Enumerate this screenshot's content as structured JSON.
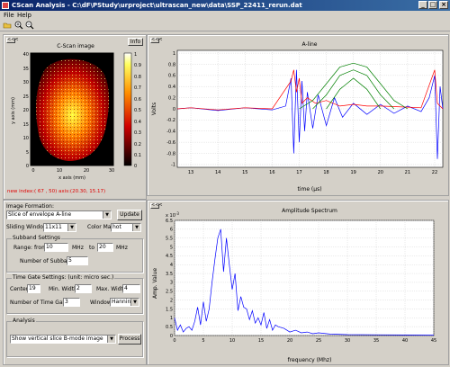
{
  "window": {
    "title": "CScan Analysis - C:\\dF\\PStudy\\urproject\\ultrascan_new\\data\\SSP_22411_rerun.dat",
    "minimize": "_",
    "maximize": "□",
    "close": "×"
  },
  "menu": {
    "file": "File",
    "help": "Help"
  },
  "cscan": {
    "collapse": "<<<",
    "title": "C-Scan image",
    "info_button": "Info",
    "xlabel": "x axis (mm)",
    "ylabel": "y axis (mm)",
    "xticks": [
      "0",
      "10",
      "20",
      "30"
    ],
    "yticks": [
      "0",
      "5",
      "10",
      "15",
      "20",
      "25",
      "30",
      "35",
      "40"
    ],
    "colorbar_ticks": [
      "0",
      "0.1",
      "0.2",
      "0.3",
      "0.4",
      "0.5",
      "0.6",
      "0.7",
      "0.8",
      "0.9",
      "1"
    ],
    "new_index": "new index:( 67 , 50)   axis:(20.30, 15.17)"
  },
  "controls": {
    "image_formation_label": "Image Formation:",
    "image_formation_value": "Slice of envelope A-line",
    "update_button": "Update",
    "sliding_window_label": "Sliding Window:",
    "sliding_window_value": "11x11",
    "color_map_label": "Color Map:",
    "color_map_value": "hot",
    "subband": {
      "title": "Subband Settings",
      "range_label": "Range:  from:",
      "range_from": "10",
      "mhz1": "MHz",
      "to_label": "to",
      "range_to": "20",
      "mhz2": "MHz",
      "num_subbands_label": "Number of Subbands:",
      "num_subbands": "5"
    },
    "timegate": {
      "title": "Time Gate Settings:  (unit: micro sec.)",
      "center_label": "Center:",
      "center": "19",
      "min_width_label": "Min. Width:",
      "min_width": "2",
      "max_width_label": "Max. Width:",
      "max_width": "4",
      "num_gates_label": "Number of Time Gates:",
      "num_gates": "3",
      "window_label": "Window:",
      "window_value": "Hanning"
    },
    "analysis": {
      "title": "Analysis",
      "select_value": "Show vertical slice B-mode image",
      "process_button": "Process"
    }
  },
  "aline": {
    "collapse": "<<<",
    "chart_data": {
      "type": "line",
      "title": "A-line",
      "xlabel": "time (µs)",
      "ylabel": "Volts",
      "xlim": [
        12.5,
        22.3
      ],
      "ylim": [
        -1.05,
        1.05
      ],
      "xticks": [
        "13",
        "14",
        "15",
        "16",
        "17",
        "18",
        "19",
        "20",
        "21",
        "22"
      ],
      "yticks": [
        "-1",
        "-0.8",
        "-0.6",
        "-0.4",
        "-0.2",
        "0",
        "0.2",
        "0.4",
        "0.6",
        "0.8",
        "1"
      ],
      "series": [
        {
          "color": "#0000ff",
          "x": [
            12.5,
            13,
            14,
            15,
            16,
            16.5,
            16.7,
            16.8,
            16.9,
            17.0,
            17.1,
            17.2,
            17.3,
            17.5,
            17.7,
            18,
            18.3,
            18.6,
            19,
            19.5,
            20,
            20.5,
            21,
            21.5,
            21.8,
            22.0,
            22.1,
            22.2,
            22.3
          ],
          "y": [
            0,
            0.02,
            -0.03,
            0.02,
            -0.02,
            0.05,
            0.55,
            -0.8,
            0.7,
            -0.6,
            0.5,
            -0.4,
            0.3,
            -0.35,
            0.25,
            -0.3,
            0.2,
            -0.15,
            0.1,
            -0.1,
            0.08,
            -0.08,
            0.05,
            -0.05,
            0.2,
            0.6,
            -0.9,
            0.4,
            0
          ]
        },
        {
          "color": "#ff0000",
          "x": [
            12.5,
            13,
            14,
            15,
            16,
            16.7,
            16.8,
            16.9,
            17.0,
            17.1,
            17.3,
            17.6,
            18,
            18.5,
            19,
            19.5,
            20,
            20.5,
            21,
            21.5,
            22.0,
            22.1,
            22.3
          ],
          "y": [
            0,
            0.02,
            -0.02,
            0.02,
            0,
            0.5,
            0.7,
            0.3,
            0.55,
            0.1,
            0.2,
            0.1,
            0.15,
            0.05,
            0.08,
            0.05,
            0.05,
            0.04,
            0.03,
            0.02,
            0.7,
            0.1,
            0
          ]
        },
        {
          "color": "#008000",
          "x": [
            17,
            17.5,
            18,
            18.5,
            19,
            19.5,
            20,
            20.5,
            21
          ],
          "y": [
            0,
            0.15,
            0.45,
            0.75,
            0.82,
            0.75,
            0.45,
            0.15,
            0
          ]
        },
        {
          "color": "#008000",
          "x": [
            17.5,
            18,
            18.5,
            19,
            19.5,
            20,
            20.5
          ],
          "y": [
            0,
            0.25,
            0.6,
            0.7,
            0.6,
            0.25,
            0
          ]
        },
        {
          "color": "#008000",
          "x": [
            18,
            18.5,
            19,
            19.5,
            20
          ],
          "y": [
            0,
            0.35,
            0.55,
            0.35,
            0
          ]
        }
      ]
    }
  },
  "spectrum": {
    "collapse": "<<<",
    "chart_data": {
      "type": "line",
      "title": "Amplitude Spectrum",
      "xlabel": "frequency (Mhz)",
      "ylabel": "Amp. Value",
      "exponent": "x 10",
      "exponent_power": "-3",
      "xlim": [
        0,
        45
      ],
      "ylim": [
        0,
        6.5
      ],
      "xticks": [
        "0",
        "5",
        "10",
        "15",
        "20",
        "25",
        "30",
        "35",
        "40",
        "45"
      ],
      "yticks": [
        "0",
        "0.5",
        "1",
        "1.5",
        "2",
        "2.5",
        "3",
        "3.5",
        "4",
        "4.5",
        "5",
        "5.5",
        "6",
        "6.5"
      ],
      "series": [
        {
          "color": "#0000ff",
          "x": [
            0,
            0.5,
            1,
            1.5,
            2,
            2.5,
            3,
            3.5,
            4,
            4.5,
            5,
            5.5,
            6,
            6.5,
            7,
            7.5,
            8,
            8.5,
            9,
            9.5,
            10,
            10.5,
            11,
            11.5,
            12,
            12.5,
            13,
            13.5,
            14,
            14.5,
            15,
            15.5,
            16,
            16.5,
            17,
            17.5,
            18,
            19,
            20,
            21,
            22,
            23,
            24,
            25,
            27,
            30,
            35,
            40,
            45
          ],
          "y": [
            1.0,
            0.3,
            0.6,
            0.2,
            0.4,
            0.5,
            0.3,
            0.8,
            1.6,
            0.6,
            1.9,
            0.8,
            1.5,
            3.0,
            4.3,
            5.5,
            6.0,
            3.6,
            5.5,
            4.0,
            2.6,
            3.5,
            1.4,
            2.2,
            1.6,
            1.5,
            0.9,
            1.4,
            0.7,
            1.0,
            0.6,
            1.3,
            0.4,
            0.9,
            0.3,
            0.6,
            0.5,
            0.4,
            0.2,
            0.3,
            0.15,
            0.2,
            0.1,
            0.15,
            0.08,
            0.05,
            0.04,
            0.03,
            0.02
          ]
        }
      ]
    }
  }
}
